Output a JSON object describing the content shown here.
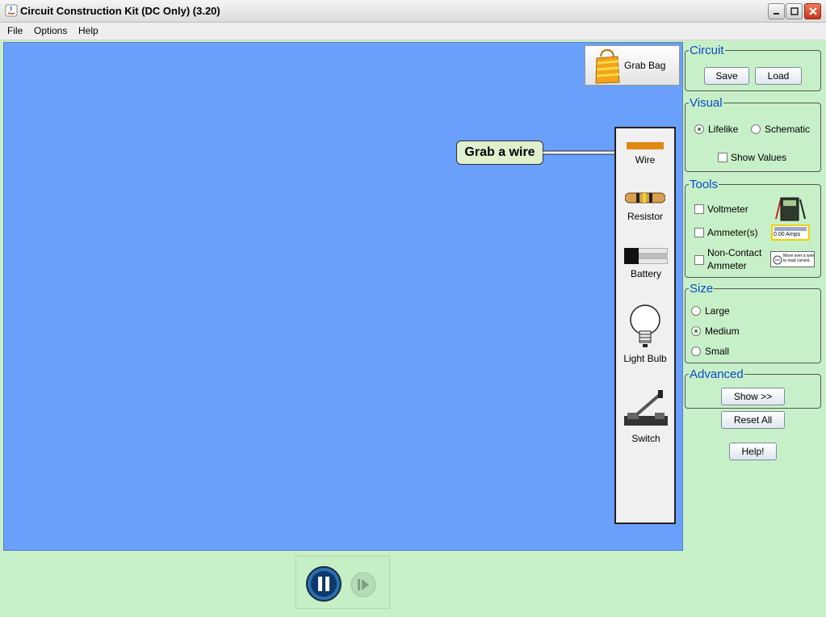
{
  "window": {
    "title": "Circuit Construction Kit (DC Only) (3.20)"
  },
  "menu": [
    "File",
    "Options",
    "Help"
  ],
  "canvas": {
    "grab_bag_label": "Grab Bag",
    "callout_text": "Grab a wire",
    "toolbox": [
      "Wire",
      "Resistor",
      "Battery",
      "Light Bulb",
      "Switch"
    ],
    "background_color": "#6aa0fb"
  },
  "panels": {
    "circuit": {
      "title": "Circuit",
      "save": "Save",
      "load": "Load"
    },
    "visual": {
      "title": "Visual",
      "lifelike": "Lifelike",
      "schematic": "Schematic",
      "selected": "Lifelike",
      "show_values": "Show Values",
      "show_values_checked": false
    },
    "tools": {
      "title": "Tools",
      "voltmeter": "Voltmeter",
      "ammeter": "Ammeter(s)",
      "noncontact_1": "Non-Contact",
      "noncontact_2": "Ammeter",
      "ammeter_readout": "0.00 Amps",
      "noncontact_readout": "Move over a wire to read current."
    },
    "size": {
      "title": "Size",
      "large": "Large",
      "medium": "Medium",
      "small": "Small",
      "selected": "Medium"
    },
    "advanced": {
      "title": "Advanced",
      "show": "Show >>"
    },
    "reset_all": "Reset All",
    "help": "Help!"
  },
  "colors": {
    "accent_title": "#0a48c8",
    "panel_bg": "#c8f0c8"
  }
}
